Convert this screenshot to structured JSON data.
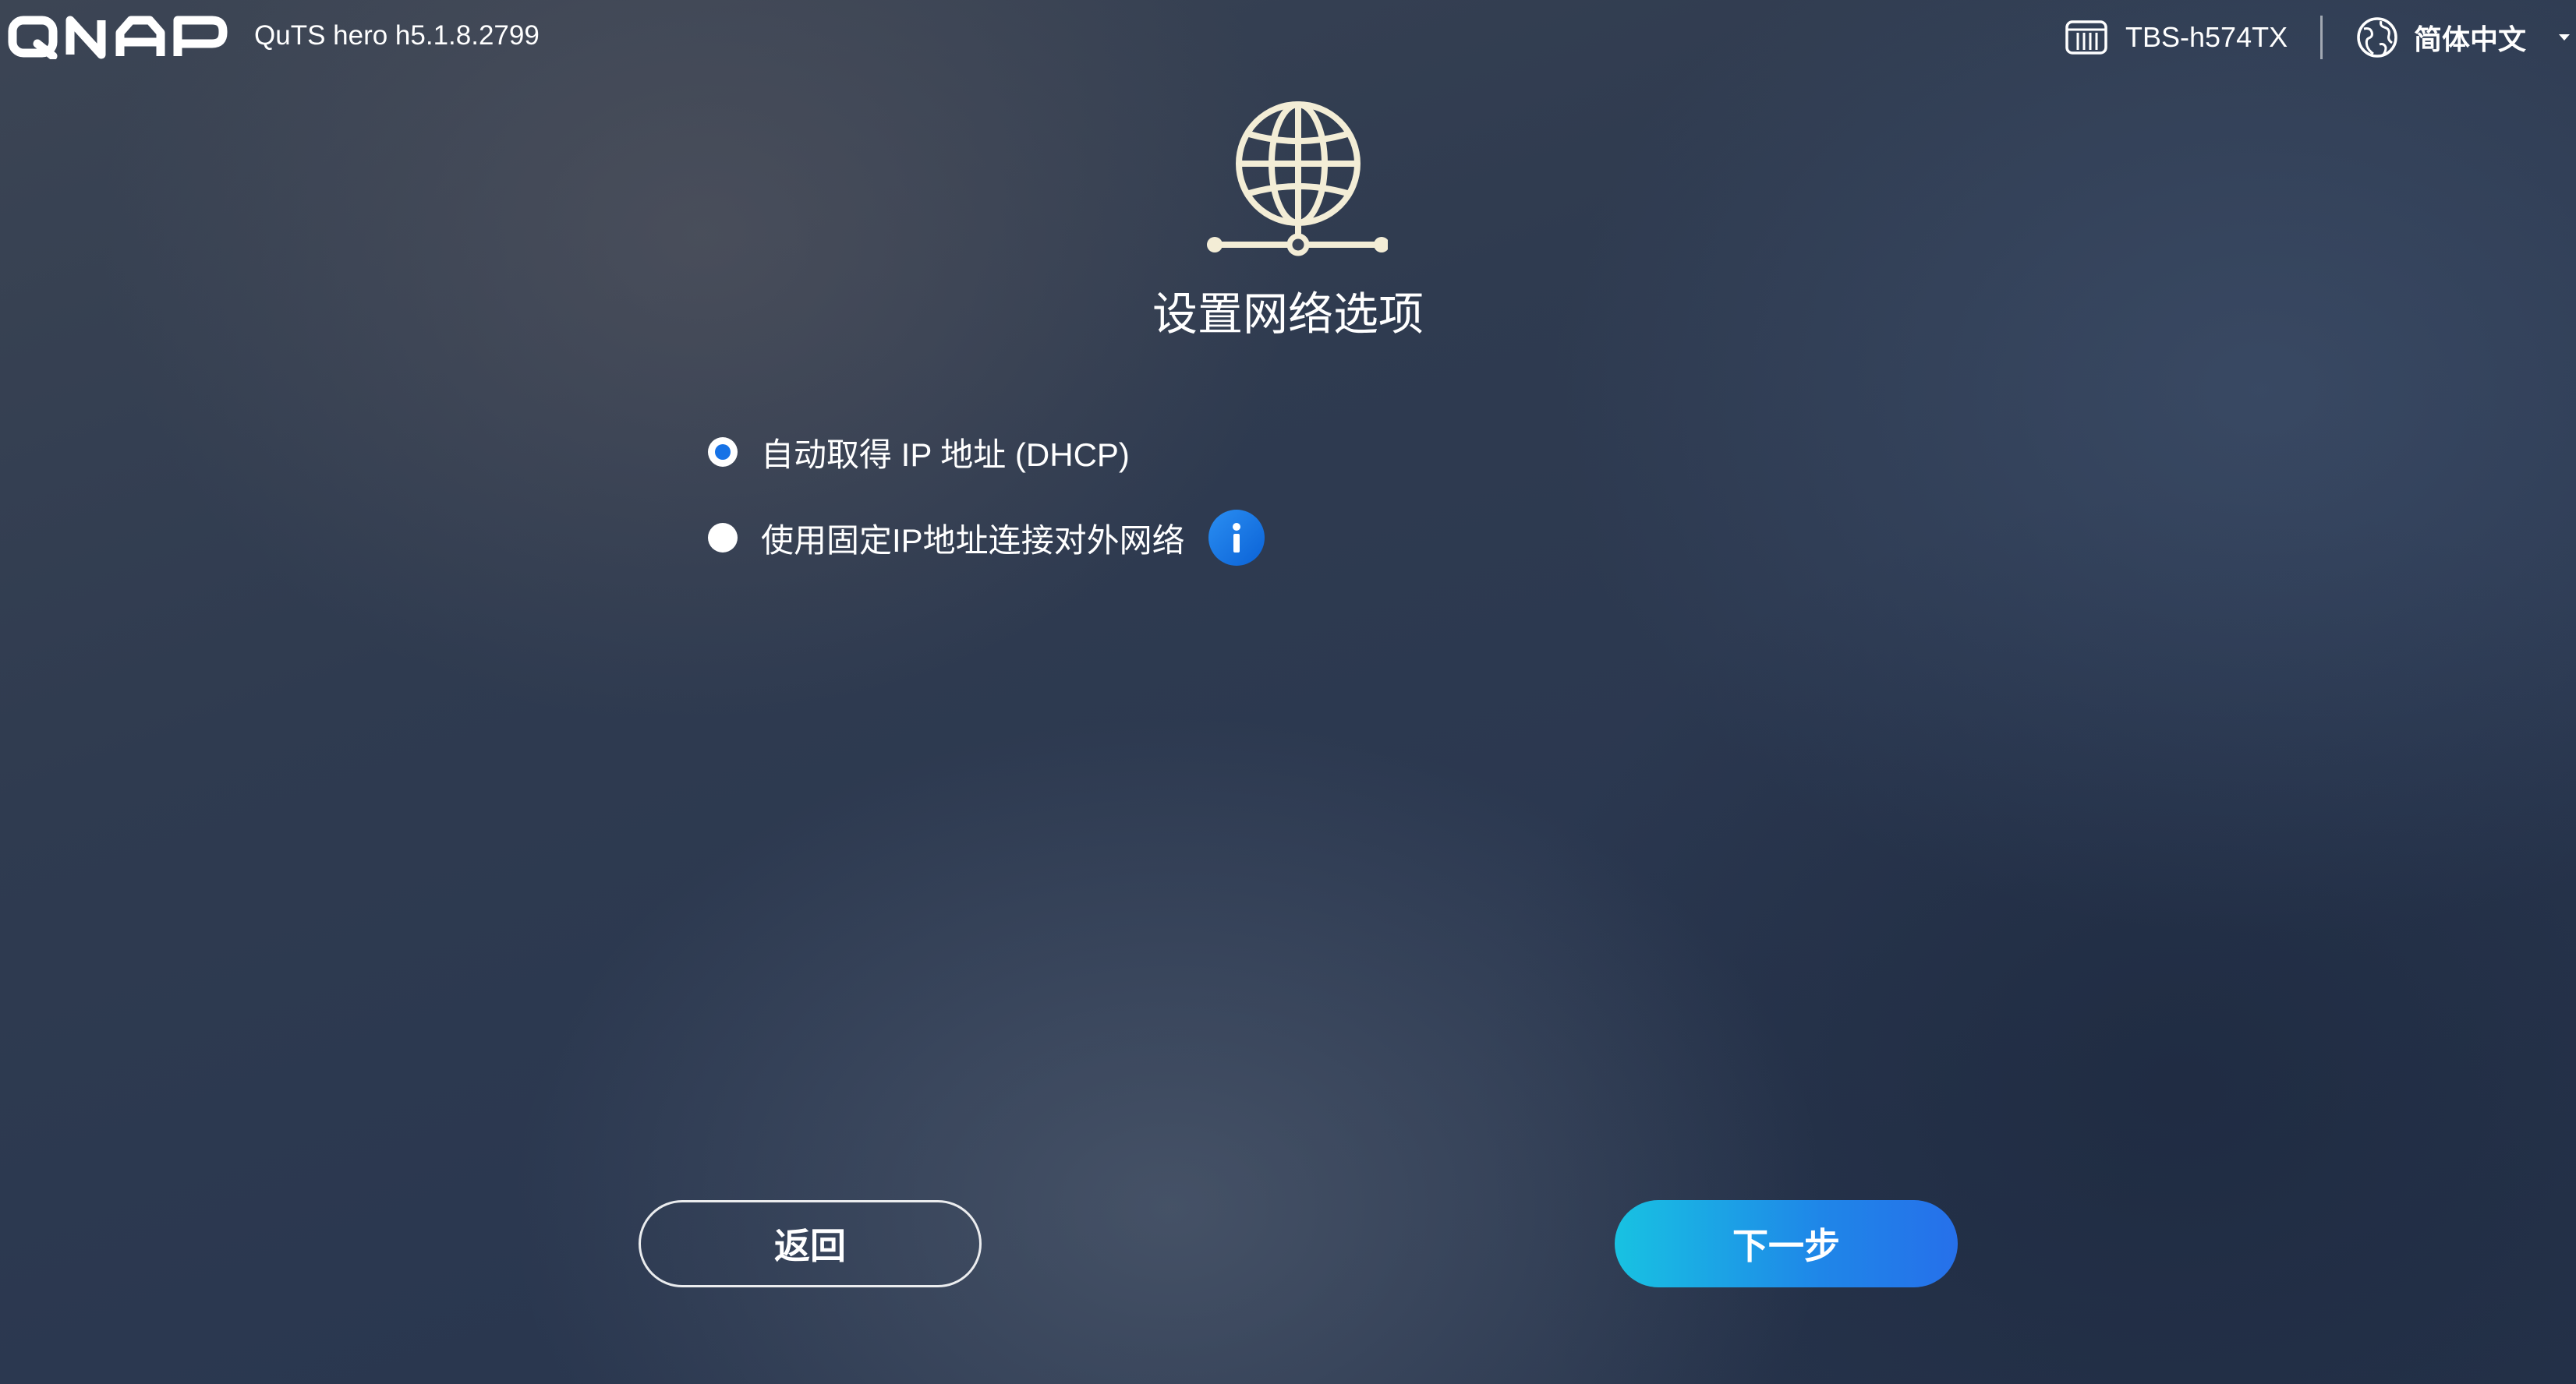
{
  "header": {
    "brand": "QNAP",
    "version": "QuTS hero h5.1.8.2799",
    "device_icon": "nas-device-icon",
    "device_name": "TBS-h574TX",
    "language_icon": "globe-icon",
    "language": "简体中文",
    "language_dropdown_icon": "caret-down-icon"
  },
  "main": {
    "header_icon": "network-globe-icon",
    "title": "设置网络选项",
    "options": [
      {
        "label": "自动取得 IP 地址 (DHCP)",
        "selected": true
      },
      {
        "label": "使用固定IP地址连接对外网络",
        "selected": false,
        "info_icon": "info-icon"
      }
    ]
  },
  "footer": {
    "back_label": "返回",
    "next_label": "下一步"
  },
  "colors": {
    "accent": "#1672e6",
    "next_gradient_start": "#18c2e2",
    "next_gradient_end": "#2670ea",
    "graphic": "#f3edd6"
  }
}
